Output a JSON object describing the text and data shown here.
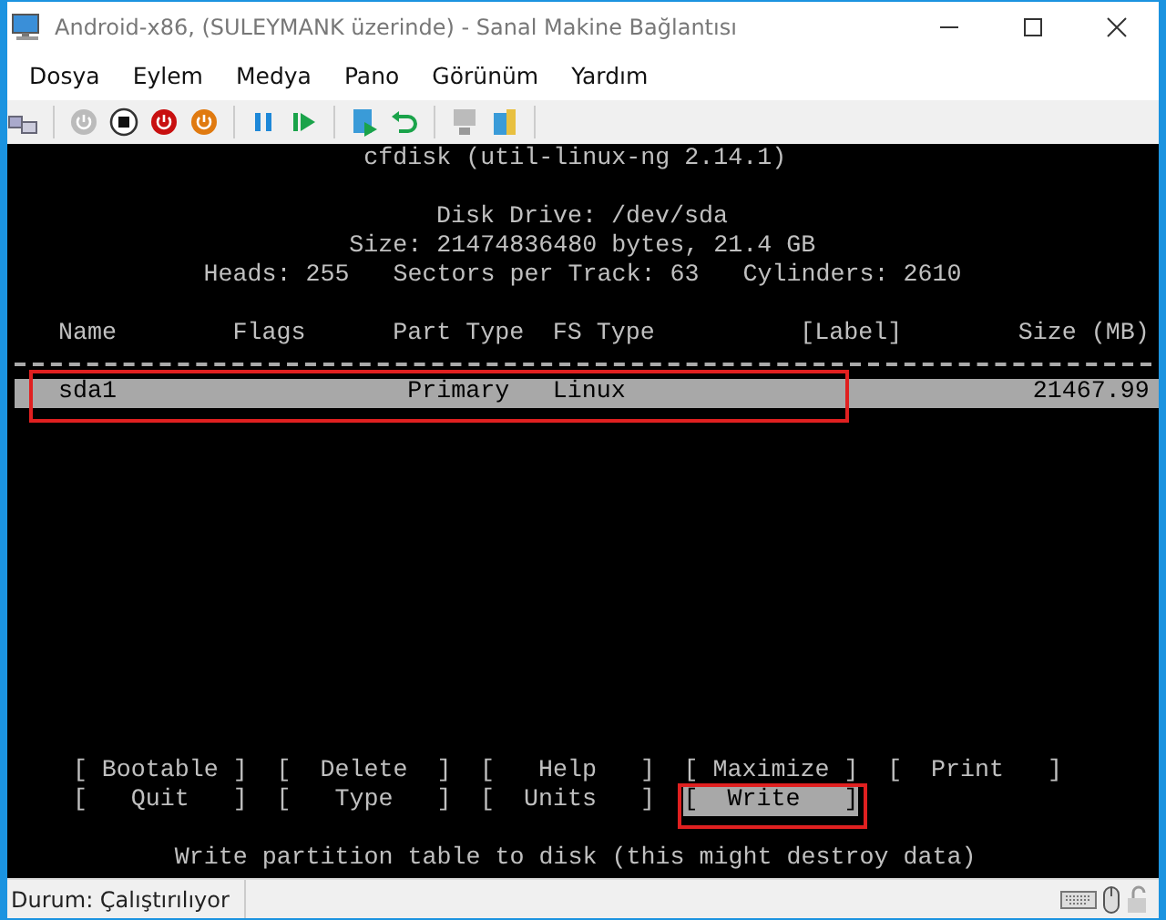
{
  "window": {
    "title": "Android-x86, (SULEYMANK üzerinde) - Sanal Makine Bağlantısı"
  },
  "menu": [
    "Dosya",
    "Eylem",
    "Medya",
    "Pano",
    "Görünüm",
    "Yardım"
  ],
  "terminal": {
    "title": "cfdisk (util-linux-ng 2.14.1)",
    "disk_info": [
      "Disk Drive: /dev/sda",
      "Size: 21474836480 bytes, 21.4 GB",
      "Heads: 255   Sectors per Track: 63   Cylinders: 2610"
    ],
    "columns": [
      "Name",
      "Flags",
      "Part Type",
      "FS Type",
      "[Label]",
      "Size (MB)"
    ],
    "rows": [
      {
        "name": "sda1",
        "part_type": "Primary",
        "fs_type": "Linux",
        "size": "21467.99",
        "selected": true
      }
    ],
    "commands": [
      {
        "label": "[ Bootable ]",
        "selected": false
      },
      {
        "label": "[  Delete  ]",
        "selected": false
      },
      {
        "label": "[   Help   ]",
        "selected": false
      },
      {
        "label": "[ Maximize ]",
        "selected": false
      },
      {
        "label": "[  Print   ]",
        "selected": false
      },
      {
        "label": "[   Quit   ]",
        "selected": false
      },
      {
        "label": "[   Type   ]",
        "selected": false
      },
      {
        "label": "[  Units   ]",
        "selected": false
      },
      {
        "label": "[  Write   ]",
        "selected": true
      }
    ],
    "message": "Write partition table to disk (this might destroy data)"
  },
  "status_bar": {
    "text": "Durum: Çalıştırılıyor"
  }
}
